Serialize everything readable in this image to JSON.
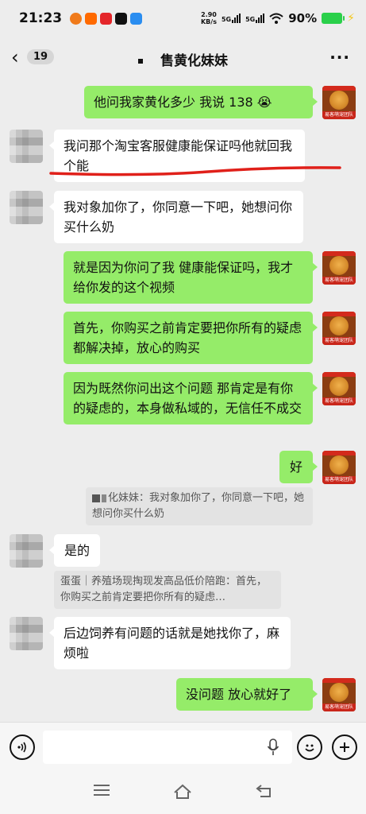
{
  "status": {
    "time": "21:23",
    "speed_value": "2.90",
    "speed_unit": "KB/s",
    "sig1": "5G",
    "sig2": "5G",
    "battery": "90%"
  },
  "nav": {
    "back_count": "19",
    "title": "售黄化妹妹"
  },
  "messages": [
    {
      "side": "right",
      "text": "他问我家黄化多少  我说 138 😭"
    },
    {
      "side": "left",
      "text": "我问那个淘宝客服健康能保证吗他就回我个能"
    },
    {
      "side": "left",
      "text": "我对象加你了，你同意一下吧，她想问你买什么奶"
    },
    {
      "side": "right",
      "text": "就是因为你问了我 健康能保证吗，我才给你发的这个视频"
    },
    {
      "side": "right",
      "text": "首先，你购买之前肯定要把你所有的疑虑都解决掉，放心的购买"
    },
    {
      "side": "right",
      "text": "因为既然你问出这个问题 那肯定是有你的疑虑的，本身做私域的，无信任不成交"
    },
    {
      "side": "right",
      "text": "好"
    },
    {
      "side": "left",
      "text": "是的"
    },
    {
      "side": "left",
      "text": "后边饲养有问题的话就是她找你了，麻烦啦"
    },
    {
      "side": "right",
      "text": "没问题 放心就好了"
    }
  ],
  "quotes": [
    {
      "text": "化妹妹：我对象加你了，你同意一下吧，她想问你买什么奶"
    },
    {
      "text": "蛋蛋｜养殖场现掏现发高品低价陪跑：首先，你购买之前肯定要把你所有的疑虑…"
    }
  ],
  "avatar_caption": "易客萌宠团队",
  "colors": {
    "bubble_right": "#95ec69",
    "bubble_left": "#ffffff",
    "background": "#ededed",
    "annotation": "#e0201a"
  },
  "icons": {
    "voice": "voice-icon",
    "emoji": "emoji-icon",
    "plus": "plus-icon",
    "mic": "mic-icon"
  }
}
